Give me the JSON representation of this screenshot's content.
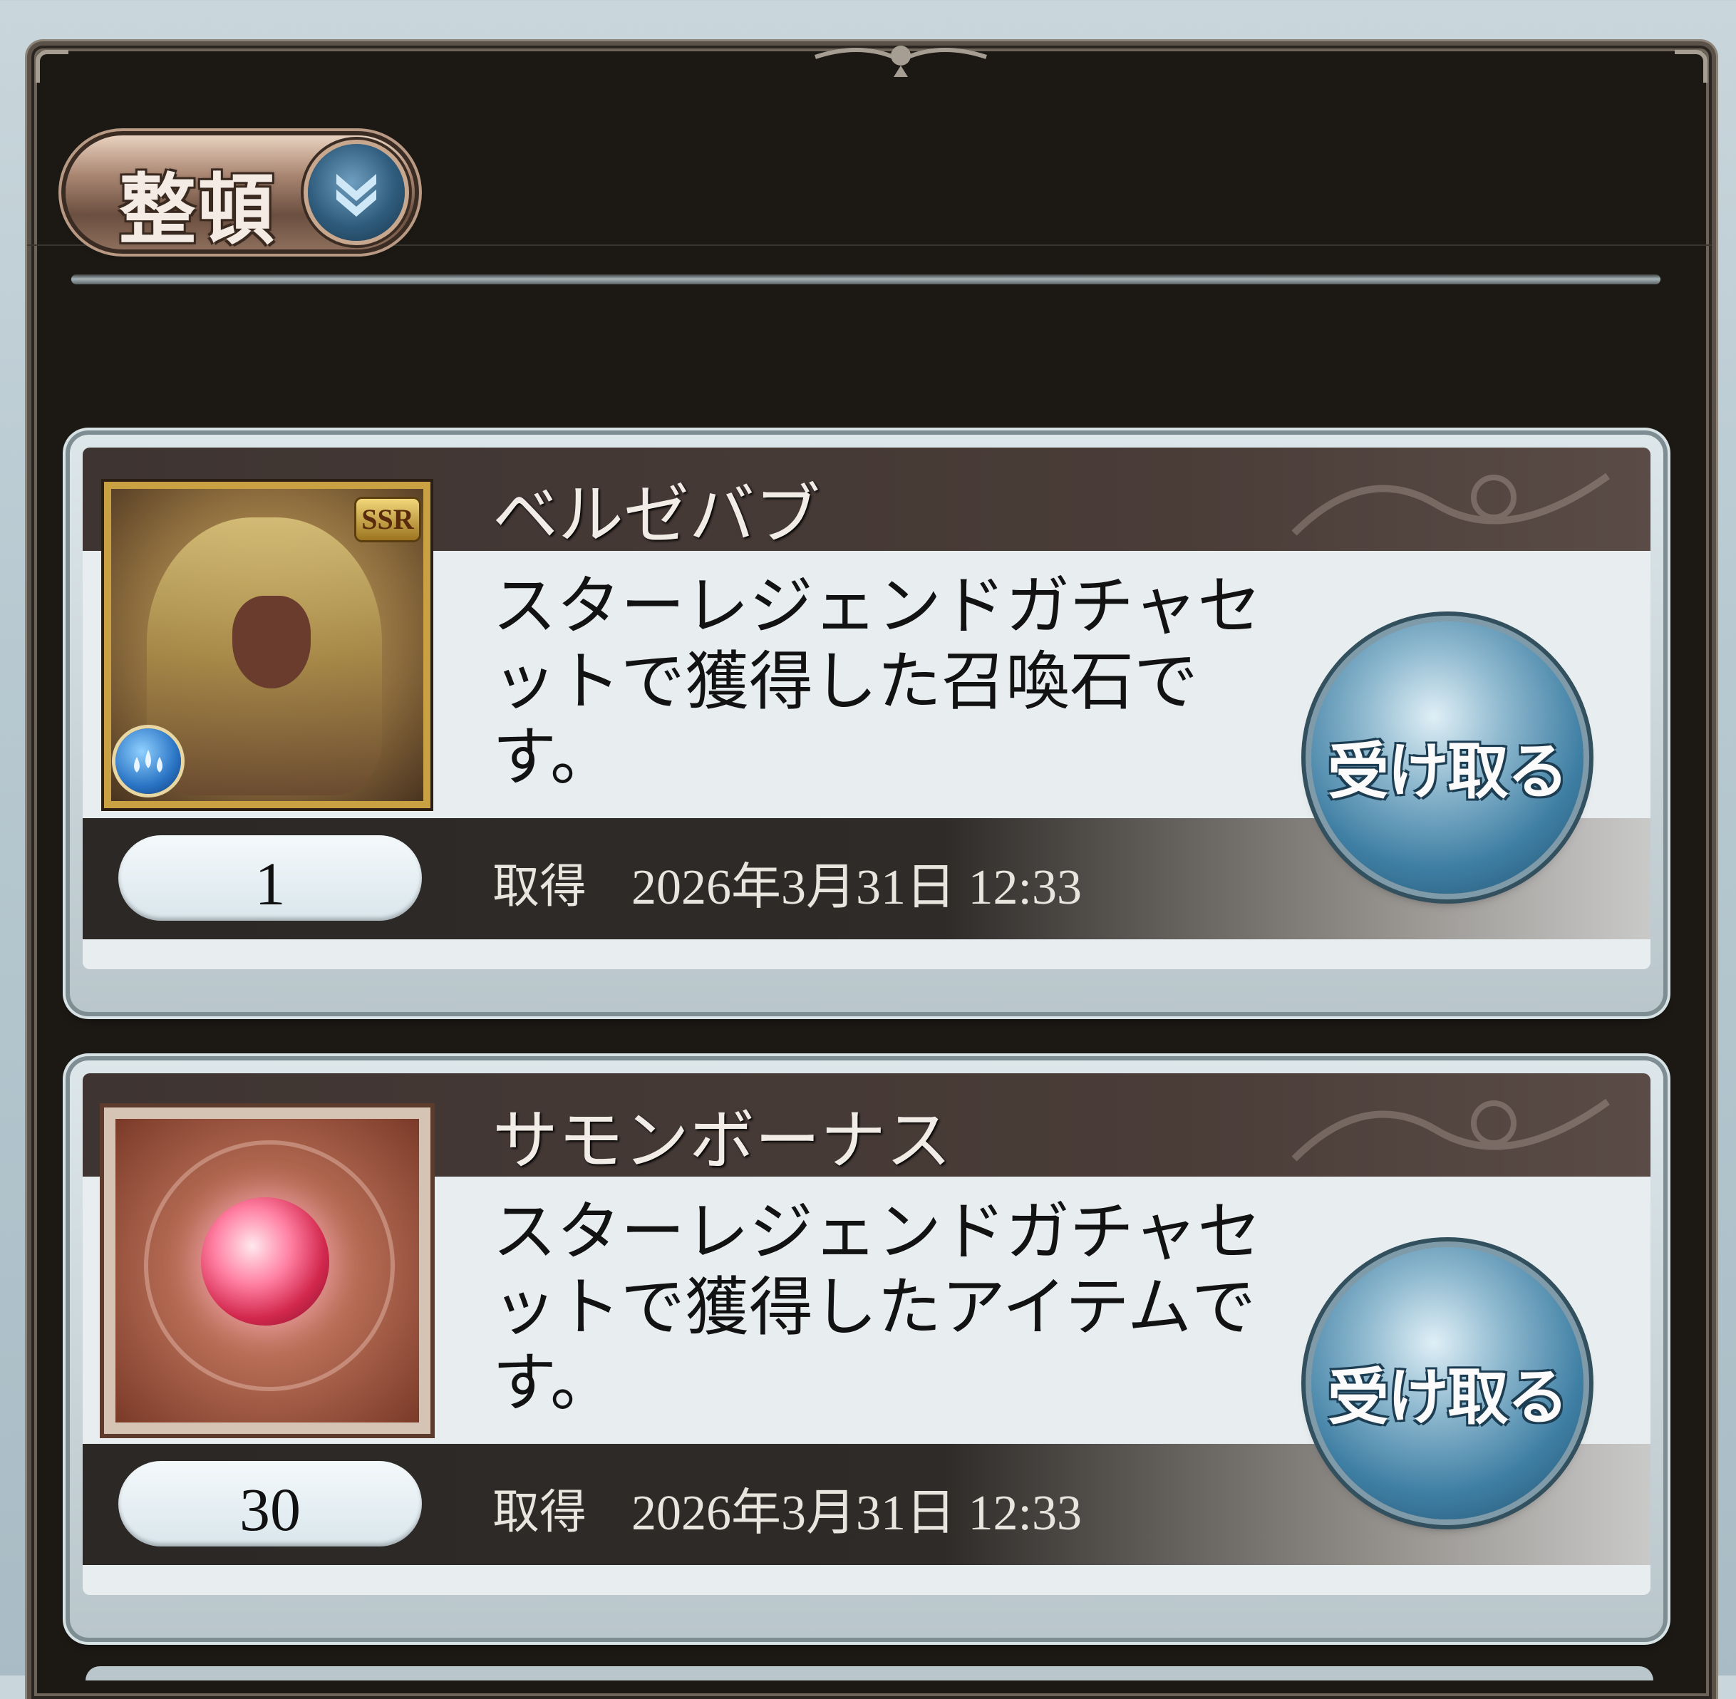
{
  "sort_button": {
    "label": "整頓",
    "icon": "double-chevron-down-icon"
  },
  "items": [
    {
      "title": "ベルゼバブ",
      "description": "スターレジェンドガチャセットで獲得した召喚石です。",
      "quantity": "1",
      "acquired_label": "取得",
      "acquired_date": "2026年3月31日 12:33",
      "receive_label": "受け取る",
      "rarity": "SSR",
      "thumbnail": "summon-portrait",
      "element": "water-icon"
    },
    {
      "title": "サモンボーナス",
      "description": "スターレジェンドガチャセットで獲得したアイテムです。",
      "quantity": "30",
      "acquired_label": "取得",
      "acquired_date": "2026年3月31日 12:33",
      "receive_label": "受け取る",
      "thumbnail": "red-orb-icon"
    }
  ],
  "colors": {
    "panel": "#1c1915",
    "title_bar": "#3e3431",
    "receive_button": "#3f7fa4"
  }
}
